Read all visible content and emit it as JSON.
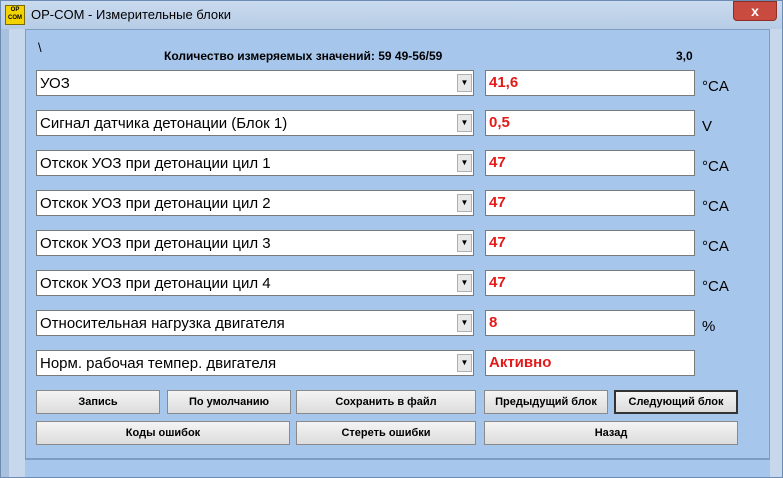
{
  "window": {
    "title": "OP-COM - Измерительные блоки",
    "icon_text": "OP COM",
    "close_label": "x"
  },
  "header": {
    "backslash": "\\",
    "count_text": "Количество измеряемых значений: 59  49-56/59",
    "version": "3,0"
  },
  "rows": [
    {
      "label": "УОЗ",
      "value": "41,6",
      "unit": "°CA"
    },
    {
      "label": "Сигнал датчика детонации (Блок 1)",
      "value": "0,5",
      "unit": "V"
    },
    {
      "label": "Отскок УОЗ при детонации цил 1",
      "value": "47",
      "unit": "°CA"
    },
    {
      "label": "Отскок УОЗ при детонации цил 2",
      "value": "47",
      "unit": "°CA"
    },
    {
      "label": "Отскок УОЗ при детонации цил 3",
      "value": "47",
      "unit": "°CA"
    },
    {
      "label": "Отскок УОЗ при детонации цил 4",
      "value": "47",
      "unit": "°CA"
    },
    {
      "label": "Относительная нагрузка двигателя",
      "value": "8",
      "unit": "%"
    },
    {
      "label": "Норм. рабочая темпер. двигателя",
      "value": "Активно",
      "unit": ""
    }
  ],
  "buttons": {
    "record": "Запись",
    "default": "По умолчанию",
    "save_file": "Сохранить в файл",
    "prev_block": "Предыдущий блок",
    "next_block": "Следующий блок",
    "error_codes": "Коды ошибок",
    "clear_errors": "Стереть ошибки",
    "back": "Назад"
  },
  "colors": {
    "value_text": "#e21a1a",
    "client_bg": "#a6c6ec"
  },
  "icons": {
    "dropdown": "chevron-down-icon",
    "app": "opcom-app-icon"
  }
}
